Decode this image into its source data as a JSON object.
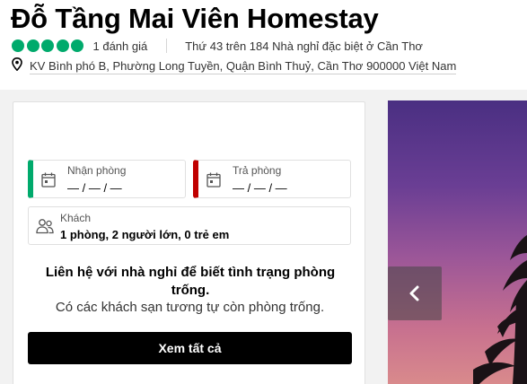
{
  "header": {
    "title": "Đỗ Tầng Mai Viên Homestay",
    "rating_bubbles": 5,
    "review_count": "1 đánh giá",
    "rank_text": "Thứ 43 trên 184 Nhà nghỉ đặc biệt ở Cần Thơ",
    "address": "KV Bình phó B, Phường Long Tuyền, Quận Bình Thuỷ, Cần Thơ 900000 Việt Nam"
  },
  "booking": {
    "checkin_label": "Nhận phòng",
    "checkin_value": "— / — / —",
    "checkout_label": "Trả phòng",
    "checkout_value": "— / — / —",
    "guests_label": "Khách",
    "guests_value": "1 phòng, 2 người lớn, 0 trẻ em",
    "contact_message": "Liên hệ với nhà nghỉ để biết tình trạng phòng trống.",
    "similar_message": "Có các khách sạn tương tự còn phòng trống.",
    "see_all_label": "Xem tất cả"
  },
  "icons": {
    "rating": "rating-bubble-icon",
    "location": "map-pin-icon",
    "checkin": "calendar-icon",
    "checkout": "calendar-icon",
    "guests": "people-icon",
    "gallery_prev": "chevron-left-icon"
  },
  "colors": {
    "rating_green": "#00aa6c",
    "checkin_accent": "#00aa6c",
    "checkout_accent": "#c00000",
    "button_bg": "#000000"
  }
}
